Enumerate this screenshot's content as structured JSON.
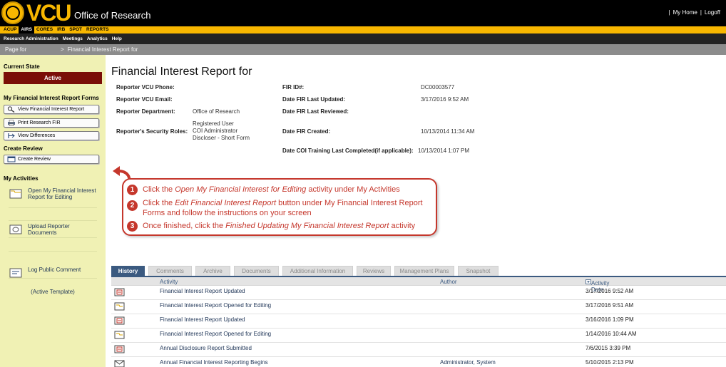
{
  "header": {
    "brand": "VCU",
    "brand_sub": "Office of Research",
    "links": [
      "My Home",
      "Logoff"
    ],
    "separator": "|"
  },
  "nav_primary": [
    {
      "label": "ACUP",
      "active": false
    },
    {
      "label": "AIRS",
      "active": true
    },
    {
      "label": "CORES",
      "active": false
    },
    {
      "label": "IRB",
      "active": false
    },
    {
      "label": "SPOT",
      "active": false
    },
    {
      "label": "REPORTS",
      "active": false
    }
  ],
  "nav_secondary": [
    "Research Administration",
    "Meetings",
    "Analytics",
    "Help"
  ],
  "breadcrumb": {
    "first": "Page for",
    "arrow": ">",
    "second": "Financial Interest Report for"
  },
  "sidebar": {
    "current_state_heading": "Current State",
    "state": "Active",
    "forms_heading": "My Financial Interest Report Forms",
    "form_buttons": [
      "View Financial Interest Report",
      "Print Research FIR",
      "View Differences"
    ],
    "create_review_heading": "Create Review",
    "create_review_button": "Create Review",
    "activities_heading": "My Activities",
    "activities": [
      "Open My Financial Interest Report for Editing",
      "Upload Reporter Documents",
      "Log Public Comment"
    ],
    "template_text": "(Active Template)"
  },
  "main": {
    "title": "Financial Interest Report for",
    "left_fields": [
      {
        "label": "Reporter VCU Phone:",
        "value": ""
      },
      {
        "label": "Reporter VCU Email:",
        "value": ""
      },
      {
        "label": "Reporter Department:",
        "value": "Office of Research"
      },
      {
        "label": "Reporter's Security Roles:",
        "value": "Registered User\nCOI Administrator\nDiscloser - Short Form"
      }
    ],
    "right_fields": [
      {
        "label": "FIR ID#:",
        "value": "DC00003577"
      },
      {
        "label": "Date FIR Last Updated:",
        "value": "3/17/2016 9:52 AM"
      },
      {
        "label": "Date FIR Last Reviewed:",
        "value": ""
      },
      {
        "label": "Date FIR Created:",
        "value": "10/13/2014 11:34 AM"
      },
      {
        "label": "Date COI Training Last Completed(if applicable):",
        "value": "10/13/2014 1:07 PM"
      }
    ]
  },
  "callout": {
    "steps": [
      {
        "num": "1",
        "pre": "Click the ",
        "em": "Open My Financial Interest for Editing",
        "post": " activity under My Activities"
      },
      {
        "num": "2",
        "pre": "Click the ",
        "em": "Edit Financial Interest Report",
        "post": " button under My Financial Interest Report Forms and follow the instructions on your screen"
      },
      {
        "num": "3",
        "pre": "Once finished, click the ",
        "em": "Finished Updating My Financial Interest Report",
        "post": " activity"
      }
    ],
    "color": "#c5372c"
  },
  "tabs": [
    "History",
    "Comments",
    "Archive",
    "Documents",
    "Additional Information",
    "Reviews",
    "Management Plans",
    "Snapshot"
  ],
  "history": {
    "columns": {
      "activity": "Activity",
      "author": "Author",
      "date": "Activity Date"
    },
    "rows": [
      {
        "activity": "Financial Interest Report Updated",
        "author": "",
        "date": "3/17/2016 9:52 AM",
        "icon": "form-update-icon"
      },
      {
        "activity": "Financial Interest Report Opened for Editing",
        "author": "",
        "date": "3/17/2016 9:51 AM",
        "icon": "folder-open-icon"
      },
      {
        "activity": "Financial Interest Report Updated",
        "author": "",
        "date": "3/16/2016 1:09 PM",
        "icon": "form-update-icon"
      },
      {
        "activity": "Financial Interest Report Opened for Editing",
        "author": "",
        "date": "1/14/2016 10:44 AM",
        "icon": "folder-open-icon"
      },
      {
        "activity": "Annual Disclosure Report Submitted",
        "author": "",
        "date": "7/6/2015 3:39 PM",
        "icon": "form-update-icon"
      },
      {
        "activity": "Annual Financial Interest Reporting Begins",
        "author": "Administrator, System",
        "date": "5/10/2015 2:13 PM",
        "icon": "envelope-icon"
      }
    ]
  },
  "colors": {
    "brand_gold": "#f8b700",
    "state_maroon": "#7a0e07",
    "sidebar_bg": "#f0f1b4",
    "tab_active": "#3b5a80"
  }
}
